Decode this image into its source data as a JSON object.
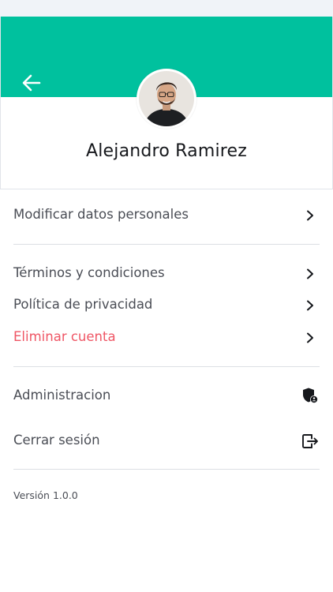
{
  "profile": {
    "name": "Alejandro Ramirez",
    "banner_color": "#00c19e"
  },
  "menu": {
    "edit_profile": "Modificar datos personales",
    "terms": "Términos y condiciones",
    "privacy": "Política de privacidad",
    "delete_account": "Eliminar cuenta",
    "admin": "Administracion",
    "logout": "Cerrar sesión"
  },
  "icons": {
    "back": "arrow-left-icon",
    "chevron": "chevron-right-icon",
    "admin": "shield-user-icon",
    "logout": "logout-icon"
  },
  "colors": {
    "accent": "#00c19e",
    "danger": "#ef5665",
    "text": "#4a4d55"
  },
  "footer": {
    "version": "Versión 1.0.0"
  }
}
